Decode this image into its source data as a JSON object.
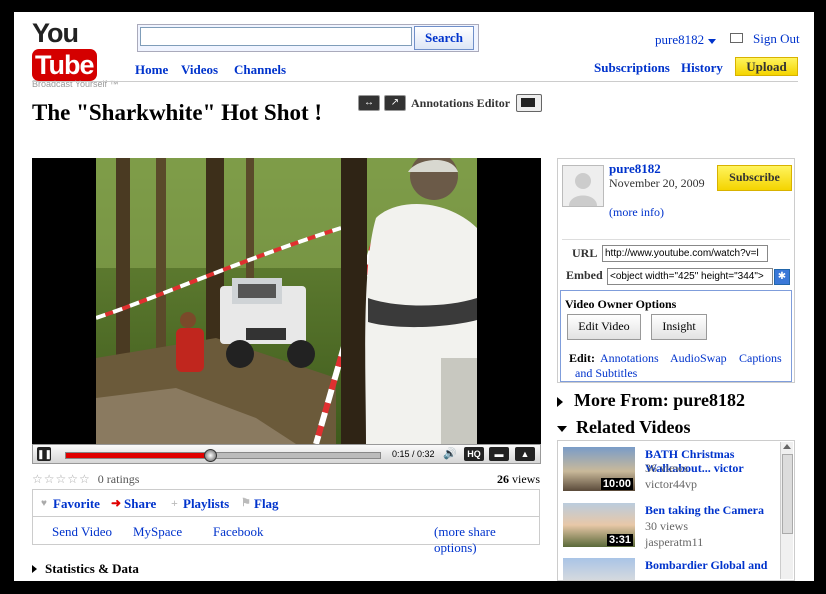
{
  "header": {
    "logo_you": "You",
    "logo_tube": "Tube",
    "logo_tagline": "Broadcast Yourself ™",
    "search_button": "Search",
    "search_value": "",
    "nav": [
      "Home",
      "Videos",
      "Channels"
    ],
    "user": "pure8182",
    "sign_out": "Sign Out",
    "subscriptions": "Subscriptions",
    "history": "History",
    "upload": "Upload"
  },
  "video": {
    "title": "The \"Sharkwhite\" Hot Shot !",
    "annotations_editor": "Annotations Editor",
    "time": "0:15 / 0:32",
    "progress_fraction": 0.46,
    "hq_label": "HQ",
    "ratings_text": "0 ratings",
    "views_count": "26",
    "views_label": "views"
  },
  "actions": {
    "favorite": "Favorite",
    "share": "Share",
    "playlists": "Playlists",
    "flag": "Flag",
    "send_video": "Send Video",
    "myspace": "MySpace",
    "facebook": "Facebook",
    "more_share": "(more share options)"
  },
  "stats_label": "Statistics & Data",
  "uploader": {
    "name": "pure8182",
    "date": "November 20, 2009",
    "more_info": "(more info)",
    "subscribe": "Subscribe",
    "url_label": "URL",
    "url_value": "http://www.youtube.com/watch?v=l",
    "embed_label": "Embed",
    "embed_value": "<object width=\"425\" height=\"344\">"
  },
  "owner": {
    "heading": "Video Owner Options",
    "edit_video": "Edit Video",
    "insight": "Insight",
    "edit_label": "Edit:",
    "links": [
      "Annotations",
      "AudioSwap",
      "Captions and Subtitles"
    ]
  },
  "more_from": "More From: pure8182",
  "related_heading": "Related Videos",
  "related": [
    {
      "title": "BATH Christmas Walkabout... victor",
      "views": "36 views",
      "user": "victor44vp",
      "duration": "10:00"
    },
    {
      "title": "Ben taking the Camera",
      "views": "30 views",
      "user": "jasperatm11",
      "duration": "3:31"
    },
    {
      "title": "Bombardier Global and",
      "views": "",
      "user": "",
      "duration": ""
    }
  ]
}
